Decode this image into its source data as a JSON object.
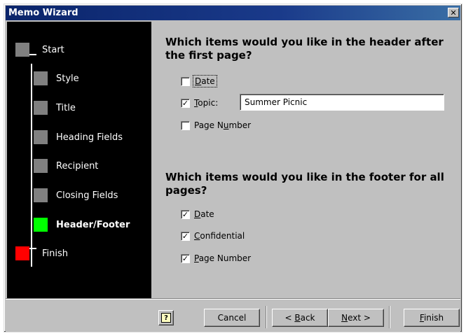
{
  "window": {
    "title": "Memo Wizard",
    "close_glyph": "✕"
  },
  "steps": [
    {
      "label": "Start",
      "state": "normal"
    },
    {
      "label": "Style",
      "state": "normal"
    },
    {
      "label": "Title",
      "state": "normal"
    },
    {
      "label": "Heading Fields",
      "state": "normal"
    },
    {
      "label": "Recipient",
      "state": "normal"
    },
    {
      "label": "Closing Fields",
      "state": "normal"
    },
    {
      "label": "Header/Footer",
      "state": "current"
    },
    {
      "label": "Finish",
      "state": "finish"
    }
  ],
  "header_section": {
    "question_line1": "Which items would you like in the header after",
    "question_line2": "the first page?",
    "date": {
      "pre": "",
      "key": "D",
      "post": "ate",
      "checked": false
    },
    "topic": {
      "pre": "",
      "key": "T",
      "post": "opic:",
      "checked": true,
      "value": "Summer Picnic"
    },
    "page_number": {
      "pre": "Page N",
      "key": "u",
      "post": "mber",
      "checked": false
    }
  },
  "footer_section": {
    "question_line1": "Which items would you like in the footer for all",
    "question_line2": "pages?",
    "date": {
      "pre": "",
      "key": "D",
      "post": "ate",
      "checked": true
    },
    "confidential": {
      "pre": "",
      "key": "C",
      "post": "onfidential",
      "checked": true
    },
    "page_number": {
      "pre": "",
      "key": "P",
      "post": "age Number",
      "checked": true
    }
  },
  "buttons": {
    "help_glyph": "?",
    "cancel": "Cancel",
    "back": {
      "pre": "< ",
      "key": "B",
      "post": "ack"
    },
    "next": {
      "pre": "",
      "key": "N",
      "post": "ext >"
    },
    "finish": {
      "pre": "",
      "key": "F",
      "post": "inish"
    }
  },
  "colors": {
    "titlebar": "#0a246a",
    "step_normal": "#808080",
    "step_current": "#00ff00",
    "step_finish": "#ff0000"
  }
}
